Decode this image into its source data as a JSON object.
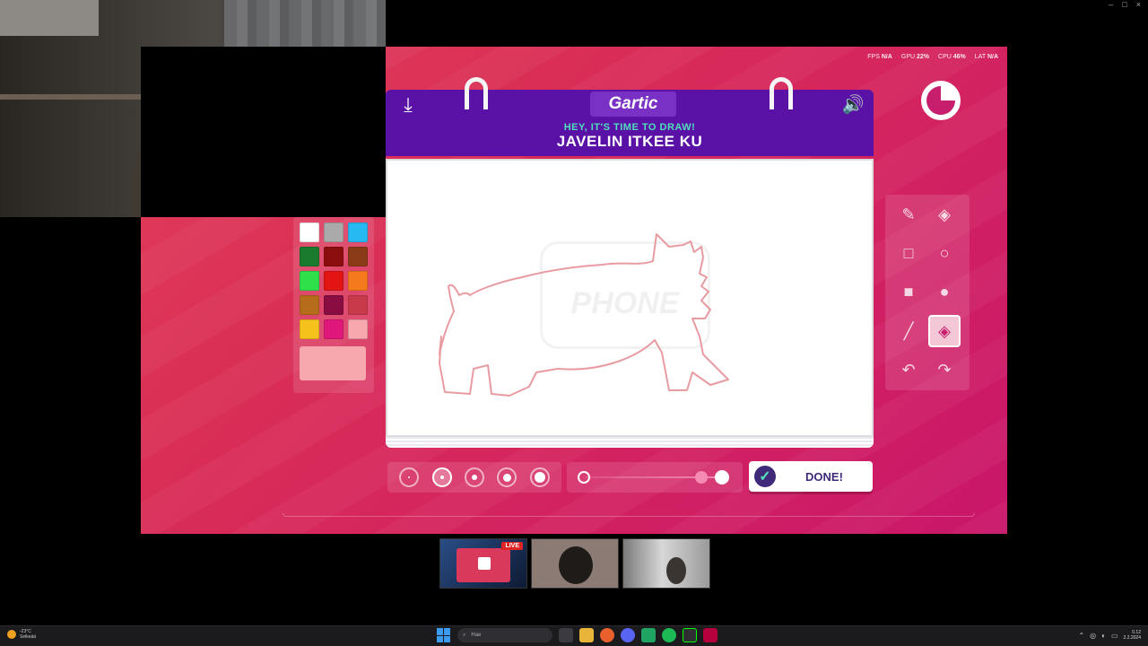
{
  "window": {
    "controls": [
      "–",
      "□",
      "×"
    ]
  },
  "perf": {
    "fps_label": "FPS",
    "fps_value": "N/A",
    "gpu_label": "GPU",
    "gpu_value": "22%",
    "cpu_label": "CPU",
    "cpu_value": "46%",
    "lat_label": "LAT",
    "lat_value": "N/A"
  },
  "game": {
    "logo": "Gartic",
    "prompt_title": "HEY, IT'S TIME TO DRAW!",
    "prompt_word": "JAVELIN ITKEE KU",
    "watermark": "PHONE",
    "done_label": "DONE!",
    "timer_remaining": 0.75,
    "brush_sizes": [
      2,
      4,
      6,
      9,
      12
    ],
    "active_size_index": 1,
    "opacity_level": 1.0,
    "current_color": "#f7a8ae",
    "drawing_color": "#e89ba0",
    "palette": [
      "#ffffff",
      "#aaaaaa",
      "#27b9f2",
      "#1a7a2e",
      "#8b0d0d",
      "#8b3a16",
      "#2ee04a",
      "#e21414",
      "#f47a1c",
      "#b56d1c",
      "#8a0d42",
      "#c83a4a",
      "#f5c21c",
      "#e0177a",
      "#f7a8ae"
    ],
    "tools": [
      {
        "name": "pencil-tool",
        "icon": "✎"
      },
      {
        "name": "eraser-tool",
        "icon": "◈"
      },
      {
        "name": "rectangle-tool",
        "icon": "□"
      },
      {
        "name": "ellipse-tool",
        "icon": "○"
      },
      {
        "name": "filled-rectangle-tool",
        "icon": "■"
      },
      {
        "name": "filled-ellipse-tool",
        "icon": "●"
      },
      {
        "name": "line-tool",
        "icon": "╱"
      },
      {
        "name": "fill-bucket-tool",
        "icon": "◈"
      },
      {
        "name": "undo-tool",
        "icon": "↶"
      },
      {
        "name": "redo-tool",
        "icon": "↷"
      }
    ],
    "active_tool_index": 7
  },
  "thumbnails": {
    "live_badge": "LIVE"
  },
  "taskbar": {
    "weather_temp": "-23°C",
    "weather_desc": "Selkeää",
    "search_placeholder": "Hae",
    "time": "0.12",
    "date": "2.2.2024"
  }
}
